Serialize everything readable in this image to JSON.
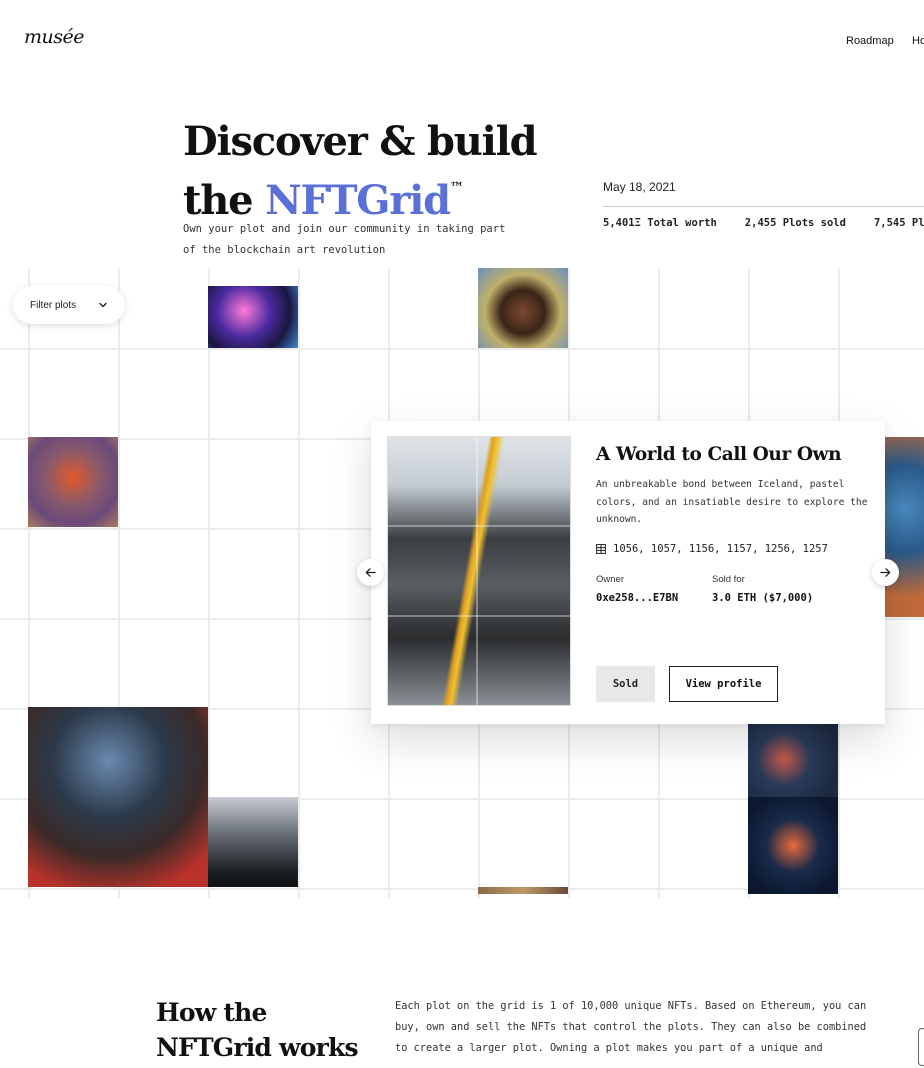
{
  "header": {
    "logo": "musée",
    "nav": [
      "Roadmap",
      "Ho"
    ]
  },
  "hero": {
    "title_line1": "Discover & build",
    "title_prefix": "the ",
    "title_accent": "NFTGrid",
    "title_mark": "™",
    "subtitle": "Own your plot and join our community in taking part of the blockchain art revolution",
    "accent_color": "#5a6fd8"
  },
  "stats": {
    "date": "May 18, 2021",
    "items": [
      "5,401Ξ Total worth",
      "2,455 Plots sold",
      "7,545 Pl"
    ]
  },
  "filter": {
    "label": "Filter plots",
    "icon": "chevron-down-icon"
  },
  "card": {
    "title": "A World to Call Our Own",
    "description": "An unbreakable bond between Iceland, pastel colors, and an insatiable desire to explore the unknown.",
    "plots": "1056, 1057, 1156, 1157, 1256, 1257",
    "plots_icon": "grid-icon",
    "owner_label": "Owner",
    "owner_value": "0xe258...E7BN",
    "sold_label": "Sold for",
    "sold_value": "3.0 ETH ($7,000)",
    "status_button": "Sold",
    "profile_button": "View profile"
  },
  "arrows": {
    "prev_icon": "arrow-left-icon",
    "next_icon": "arrow-right-icon"
  },
  "how": {
    "title_line1": "How the",
    "title_line2": "NFTGrid works",
    "text": "Each plot on the grid is 1 of 10,000 unique NFTs. Based on Ethereum, you can buy, own and sell the NFTs that control the plots. They can also be combined to create a larger plot. Owning a plot makes you part of a unique and"
  }
}
